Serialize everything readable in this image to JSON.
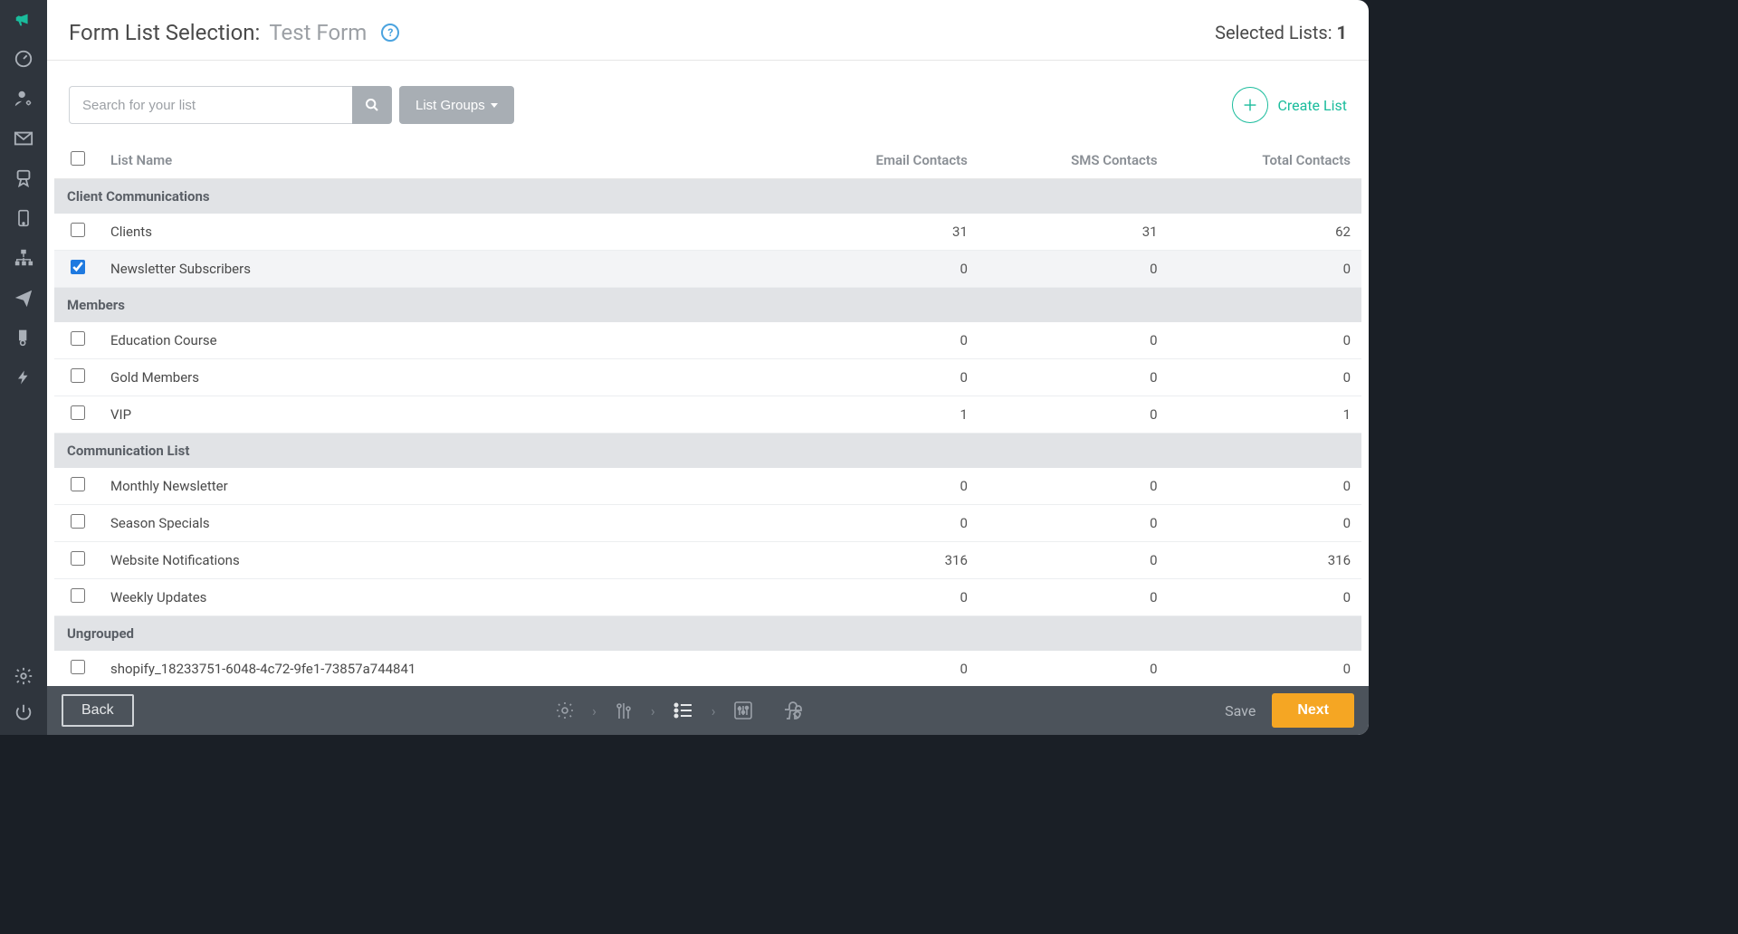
{
  "header": {
    "title_static": "Form List Selection:",
    "title_dynamic": "Test Form",
    "selected_label": "Selected Lists:",
    "selected_count": "1"
  },
  "toolbar": {
    "search_placeholder": "Search for your list",
    "groups_label": "List Groups",
    "create_label": "Create List"
  },
  "table": {
    "headers": {
      "name": "List Name",
      "email": "Email Contacts",
      "sms": "SMS Contacts",
      "total": "Total Contacts"
    },
    "groups": [
      {
        "name": "Client Communications",
        "rows": [
          {
            "name": "Clients",
            "email": "31",
            "sms": "31",
            "total": "62",
            "checked": false
          },
          {
            "name": "Newsletter Subscribers",
            "email": "0",
            "sms": "0",
            "total": "0",
            "checked": true
          }
        ]
      },
      {
        "name": "Members",
        "rows": [
          {
            "name": "Education Course",
            "email": "0",
            "sms": "0",
            "total": "0",
            "checked": false
          },
          {
            "name": "Gold Members",
            "email": "0",
            "sms": "0",
            "total": "0",
            "checked": false
          },
          {
            "name": "VIP",
            "email": "1",
            "sms": "0",
            "total": "1",
            "checked": false
          }
        ]
      },
      {
        "name": "Communication List",
        "rows": [
          {
            "name": "Monthly Newsletter",
            "email": "0",
            "sms": "0",
            "total": "0",
            "checked": false
          },
          {
            "name": "Season Specials",
            "email": "0",
            "sms": "0",
            "total": "0",
            "checked": false
          },
          {
            "name": "Website Notifications",
            "email": "316",
            "sms": "0",
            "total": "316",
            "checked": false
          },
          {
            "name": "Weekly Updates",
            "email": "0",
            "sms": "0",
            "total": "0",
            "checked": false
          }
        ]
      },
      {
        "name": "Ungrouped",
        "rows": [
          {
            "name": "shopify_18233751-6048-4c72-9fe1-73857a744841",
            "email": "0",
            "sms": "0",
            "total": "0",
            "checked": false
          }
        ]
      }
    ]
  },
  "footer": {
    "back": "Back",
    "save": "Save",
    "next": "Next"
  }
}
